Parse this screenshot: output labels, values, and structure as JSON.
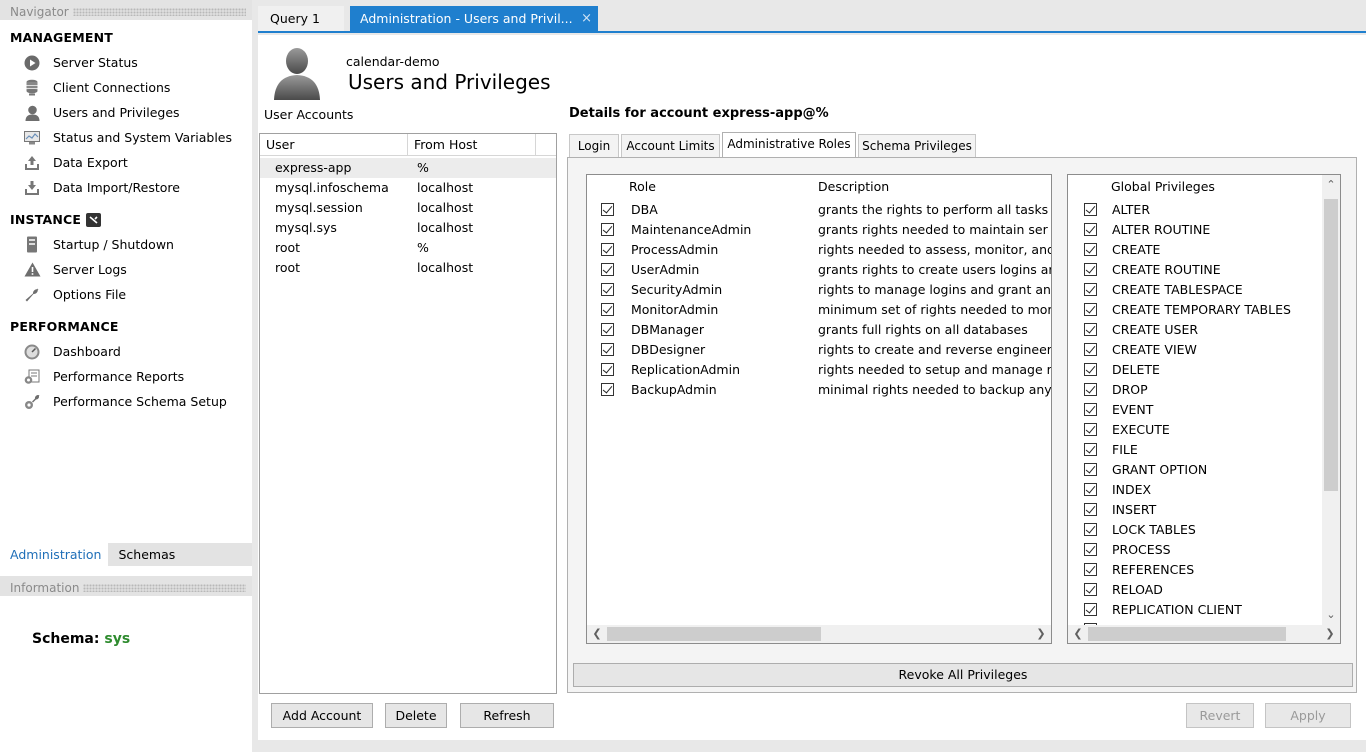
{
  "navigator": {
    "title": "Navigator",
    "sections": [
      {
        "title": "MANAGEMENT",
        "items": [
          {
            "label": "Server Status",
            "icon": "play-circle-icon"
          },
          {
            "label": "Client Connections",
            "icon": "database-icon"
          },
          {
            "label": "Users and Privileges",
            "icon": "user-icon"
          },
          {
            "label": "Status and System Variables",
            "icon": "monitor-icon"
          },
          {
            "label": "Data Export",
            "icon": "export-icon"
          },
          {
            "label": "Data Import/Restore",
            "icon": "import-icon"
          }
        ]
      },
      {
        "title": "INSTANCE",
        "items": [
          {
            "label": "Startup / Shutdown",
            "icon": "server-icon"
          },
          {
            "label": "Server Logs",
            "icon": "warning-icon"
          },
          {
            "label": "Options File",
            "icon": "wrench-icon"
          }
        ]
      },
      {
        "title": "PERFORMANCE",
        "items": [
          {
            "label": "Dashboard",
            "icon": "dashboard-icon"
          },
          {
            "label": "Performance Reports",
            "icon": "reports-icon"
          },
          {
            "label": "Performance Schema Setup",
            "icon": "schema-setup-icon"
          }
        ]
      }
    ],
    "tabs": [
      "Administration",
      "Schemas"
    ],
    "information_title": "Information",
    "schema_label": "Schema:",
    "schema_value": "sys"
  },
  "doc_tabs": {
    "query": "Query 1",
    "admin": "Administration - Users and Privil...",
    "close": "×"
  },
  "header": {
    "connection": "calendar-demo",
    "title": "Users and Privileges"
  },
  "user_accounts": {
    "label": "User Accounts",
    "columns": [
      "User",
      "From Host"
    ],
    "rows": [
      {
        "user": "express-app",
        "host": "%"
      },
      {
        "user": "mysql.infoschema",
        "host": "localhost"
      },
      {
        "user": "mysql.session",
        "host": "localhost"
      },
      {
        "user": "mysql.sys",
        "host": "localhost"
      },
      {
        "user": "root",
        "host": "%"
      },
      {
        "user": "root",
        "host": "localhost"
      }
    ],
    "buttons": {
      "add": "Add Account",
      "delete": "Delete",
      "refresh": "Refresh"
    }
  },
  "details": {
    "title": "Details for account express-app@%",
    "tabs": [
      "Login",
      "Account Limits",
      "Administrative Roles",
      "Schema Privileges"
    ],
    "roles_columns": {
      "role": "Role",
      "description": "Description"
    },
    "roles": [
      {
        "role": "DBA",
        "description": "grants the rights to perform all tasks",
        "checked": true
      },
      {
        "role": "MaintenanceAdmin",
        "description": "grants rights needed to maintain ser",
        "checked": true
      },
      {
        "role": "ProcessAdmin",
        "description": "rights needed to assess, monitor, and",
        "checked": true
      },
      {
        "role": "UserAdmin",
        "description": "grants rights to create users logins ar",
        "checked": true
      },
      {
        "role": "SecurityAdmin",
        "description": "rights to manage logins and grant an",
        "checked": true
      },
      {
        "role": "MonitorAdmin",
        "description": "minimum set of rights needed to mor",
        "checked": true
      },
      {
        "role": "DBManager",
        "description": "grants full rights on all databases",
        "checked": true
      },
      {
        "role": "DBDesigner",
        "description": "rights to create and reverse engineer",
        "checked": true
      },
      {
        "role": "ReplicationAdmin",
        "description": "rights needed to setup and manage r",
        "checked": true
      },
      {
        "role": "BackupAdmin",
        "description": "minimal rights needed to backup any",
        "checked": true
      }
    ],
    "privileges_header": "Global Privileges",
    "privileges": [
      "ALTER",
      "ALTER ROUTINE",
      "CREATE",
      "CREATE ROUTINE",
      "CREATE TABLESPACE",
      "CREATE TEMPORARY TABLES",
      "CREATE USER",
      "CREATE VIEW",
      "DELETE",
      "DROP",
      "EVENT",
      "EXECUTE",
      "FILE",
      "GRANT OPTION",
      "INDEX",
      "INSERT",
      "LOCK TABLES",
      "PROCESS",
      "REFERENCES",
      "RELOAD",
      "REPLICATION CLIENT"
    ],
    "revoke_label": "Revoke All Privileges",
    "revert_label": "Revert",
    "apply_label": "Apply"
  },
  "colors": {
    "accent": "#1f7fce",
    "schema_value": "#2e8b2e"
  }
}
